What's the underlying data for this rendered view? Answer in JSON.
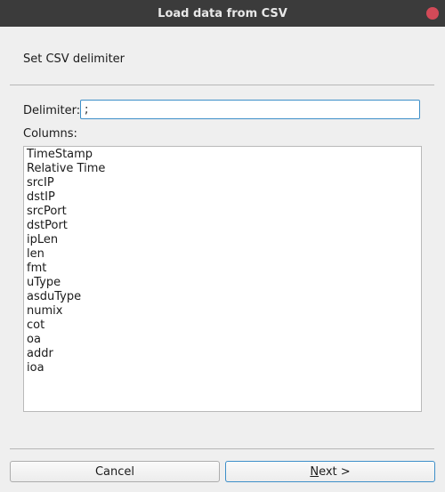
{
  "window": {
    "title": "Load data from CSV"
  },
  "header": {
    "subtitle": "Set CSV delimiter"
  },
  "form": {
    "delimiter_label": "Delimiter:",
    "delimiter_value": ";",
    "columns_label": "Columns:"
  },
  "columns": [
    "TimeStamp",
    "Relative Time",
    "srcIP",
    "dstIP",
    "srcPort",
    "dstPort",
    "ipLen",
    "len",
    "fmt",
    "uType",
    "asduType",
    "numix",
    "cot",
    "oa",
    "addr",
    "ioa"
  ],
  "buttons": {
    "cancel_label": "Cancel",
    "next_mnemonic": "N",
    "next_rest": "ext >"
  },
  "colors": {
    "titlebar": "#3b3b3b",
    "close": "#d34a58",
    "focus_border": "#3d8fc9"
  },
  "icons": {
    "close": "close-icon"
  }
}
